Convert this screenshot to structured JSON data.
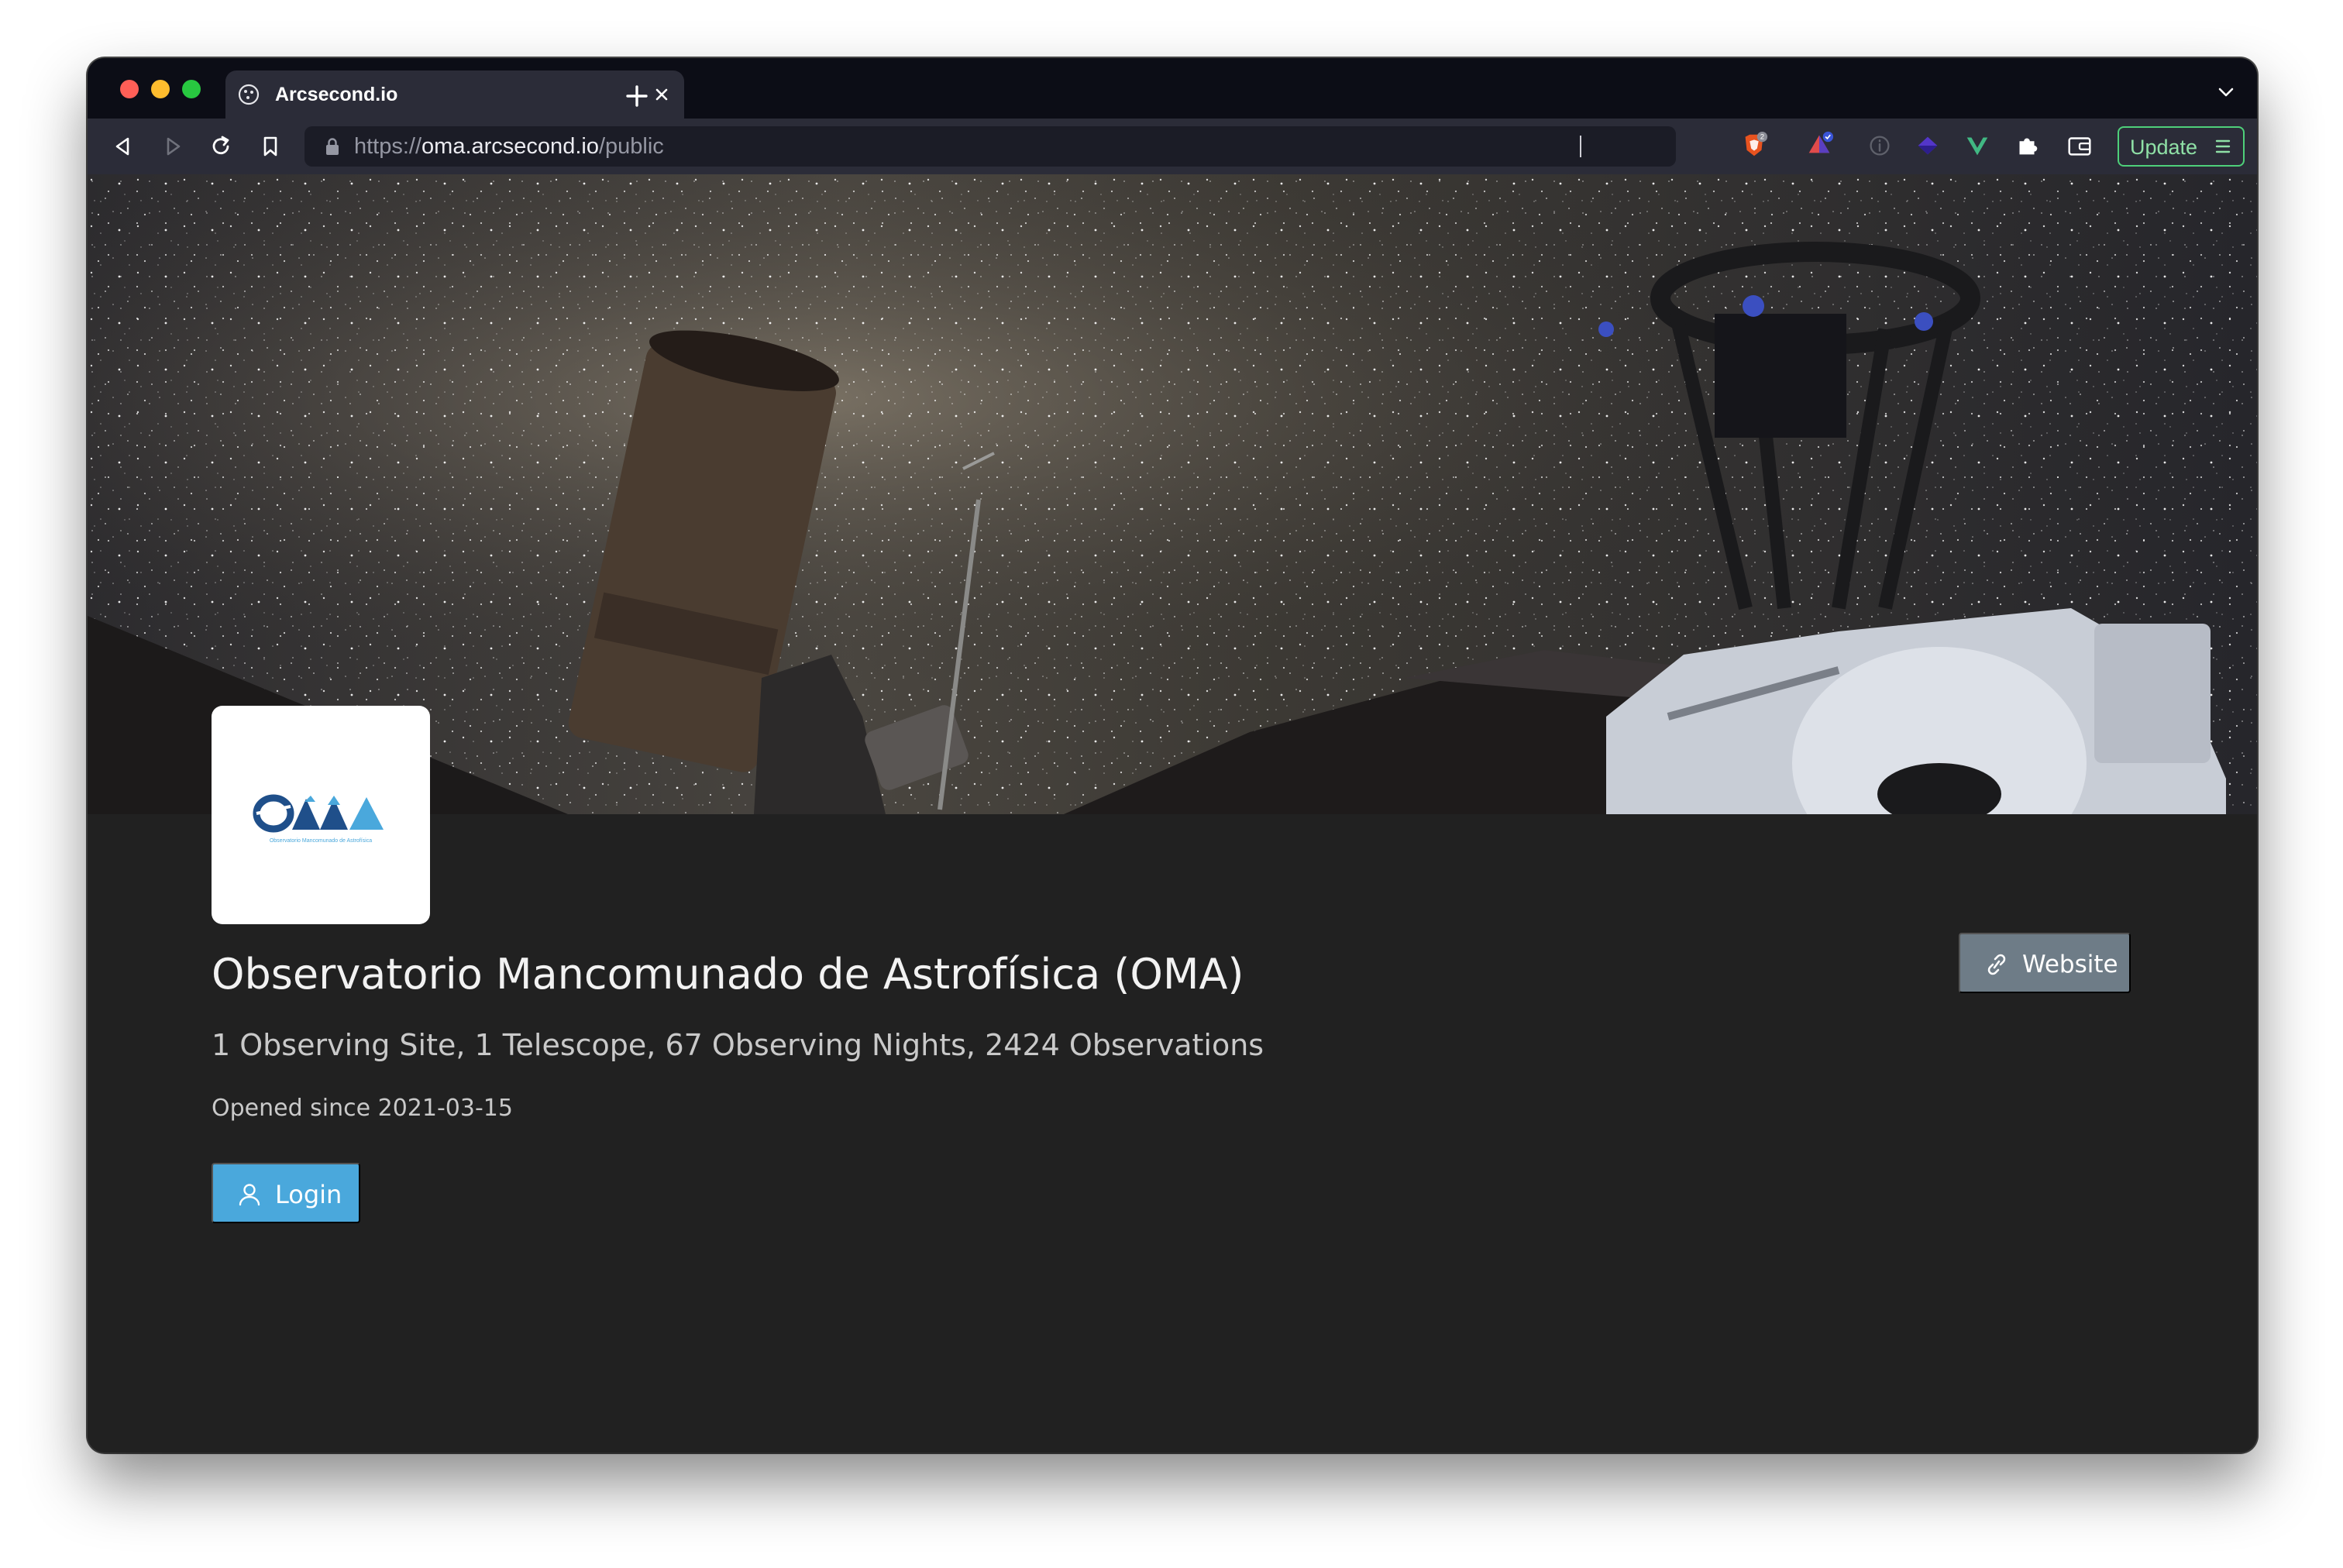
{
  "browser": {
    "tab": {
      "title": "Arcsecond.io",
      "favicon": "arcsecond-icon"
    },
    "address_bar": {
      "scheme": "https://",
      "host": "oma.arcsecond.io",
      "path": "/public"
    },
    "extensions": [
      {
        "name": "brave-shields-icon",
        "badge": "2"
      },
      {
        "name": "brave-rewards-icon"
      },
      {
        "name": "info-icon"
      },
      {
        "name": "diamond-extension-icon"
      },
      {
        "name": "vue-devtools-icon"
      },
      {
        "name": "puzzle-extensions-icon"
      },
      {
        "name": "wallet-icon"
      }
    ],
    "update_button_label": "Update",
    "colors": {
      "tabstrip": "#0c0d16",
      "toolbar": "#2b2c38",
      "update_accent": "#4ed07a"
    }
  },
  "page": {
    "logo_text": "OMA",
    "title": "Observatorio Mancomunado de Astrofísica (OMA)",
    "stats": "1 Observing Site, 1 Telescope, 67 Observing Nights, 2424 Observations",
    "opened": "Opened since 2021-03-15",
    "login_label": "Login",
    "website_label": "Website",
    "colors": {
      "background": "#212121",
      "login_button": "#4aa8dc",
      "website_button": "#6e7c87",
      "logo_blue": "#1f4f8a",
      "logo_light_blue": "#4aa8dc"
    }
  }
}
